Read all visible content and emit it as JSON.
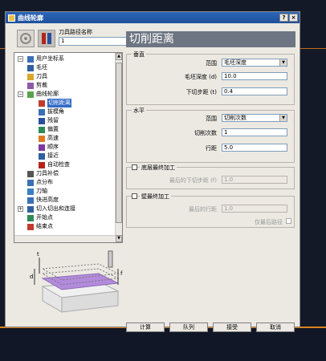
{
  "window": {
    "title": "曲线轮廓"
  },
  "titlebar_buttons": {
    "help": "?",
    "close": "×"
  },
  "toolbar": {
    "toolpath_name_label": "刀具路径名称",
    "toolpath_name_value": "1"
  },
  "page_title": "切削距离",
  "tree": {
    "items": [
      {
        "label": "用户坐标系",
        "icon": "ucs-icon"
      },
      {
        "label": "毛坯",
        "icon": "block-icon"
      },
      {
        "label": "刀具",
        "icon": "tool-icon"
      },
      {
        "label": "剪裁",
        "icon": "trim-icon"
      },
      {
        "label": "曲线轮廓",
        "icon": "curve-profile-icon"
      },
      {
        "label": "切削距离",
        "icon": "cut-distance-icon",
        "selected": true
      },
      {
        "label": "拔模角",
        "icon": "draft-angle-icon"
      },
      {
        "label": "残留",
        "icon": "rest-icon"
      },
      {
        "label": "偏置",
        "icon": "offset-icon"
      },
      {
        "label": "高速",
        "icon": "high-speed-icon"
      },
      {
        "label": "顺序",
        "icon": "order-icon"
      },
      {
        "label": "接近",
        "icon": "approach-icon"
      },
      {
        "label": "自动检查",
        "icon": "auto-check-icon"
      },
      {
        "label": "刀具补偿",
        "icon": "compensation-icon"
      },
      {
        "label": "点分布",
        "icon": "point-distribution-icon"
      },
      {
        "label": "刀轴",
        "icon": "tool-axis-icon"
      },
      {
        "label": "快进高度",
        "icon": "rapid-height-icon"
      },
      {
        "label": "切入切出和连接",
        "icon": "leads-links-icon"
      },
      {
        "label": "开始点",
        "icon": "start-point-icon"
      },
      {
        "label": "结束点",
        "icon": "end-point-icon"
      }
    ]
  },
  "vertical": {
    "title": "垂直",
    "range_label": "范围",
    "range_value": "毛坯深度",
    "stock_depth_label": "毛坯深度 (d)",
    "stock_depth_value": "10.0",
    "stepdown_label": "下切步距 (t)",
    "stepdown_value": "0.4"
  },
  "horizontal": {
    "title": "水平",
    "range_label": "范围",
    "range_value": "切削次数",
    "cut_count_label": "切削次数",
    "cut_count_value": "1",
    "stepover_label": "行距",
    "stepover_value": "5.0"
  },
  "bottom_final": {
    "title": "底层最终加工",
    "last_stepdown_label": "最后的下切步距 (f)",
    "last_stepdown_value": "1.0"
  },
  "wall_final": {
    "title": "壁最终加工",
    "last_stepover_label": "最后的行距",
    "last_stepover_value": "1.0",
    "last_pass_label": "仅最后路径"
  },
  "buttons": {
    "calculate": "计算",
    "queue": "队列",
    "accept": "接受",
    "cancel": "取消"
  },
  "preview_labels": {
    "t": "t",
    "d": "d",
    "f": "f"
  }
}
